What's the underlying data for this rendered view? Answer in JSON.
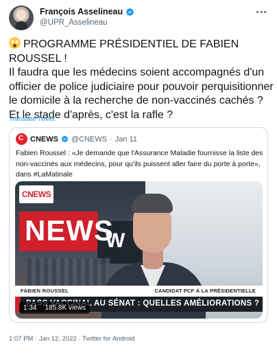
{
  "author": {
    "display_name": "François Asselineau",
    "handle": "@UPR_Asselineau",
    "verified": true
  },
  "tweet": {
    "lines": [
      "PROGRAMME PRÉSIDENTIEL DE FABIEN",
      "ROUSSEL !",
      "Il faudra que les médecins soient accompagnés d'un",
      "officier de police judiciaire pour pouvoir perquisitionner",
      "le domicile à la recherche de non-vaccinés cachés ?",
      "Et le stade d'après, c'est la rafle ?"
    ],
    "translate_label": "Translate Tweet",
    "timestamp": "1:07 PM · Jan 12, 2022 · Twitter for Android"
  },
  "quote": {
    "name": "CNEWS",
    "handle": "@CNEWS",
    "dot": "·",
    "date": "Jan 11",
    "verified": true,
    "lines": [
      "Fabien Roussel : «Je demande que l'Assurance Maladie fournisse la liste des",
      "non-vaccinés aux médecins, pour qu'ils puissent aller faire du porte à porte»,",
      "dans #LaMatinale"
    ],
    "video": {
      "corner_logo": "CNEWS",
      "studio_wall_text": "NEWS",
      "studio_wall_letter": "W",
      "lower_third_name": "FABIEN ROUSSEL",
      "lower_third_role": "CANDIDAT PCF À LA PRÉSIDENTIELLE",
      "banner_text": "PASS VACCINAL AU SÉNAT : QUELLES AMÉLIORATIONS ?",
      "duration": "1:34",
      "views": "185.8K views"
    }
  },
  "colors": {
    "accent": "#1d9bf0",
    "secondary_text": "#536471",
    "cnews_red": "#d0202b",
    "border": "#cfd9de"
  }
}
